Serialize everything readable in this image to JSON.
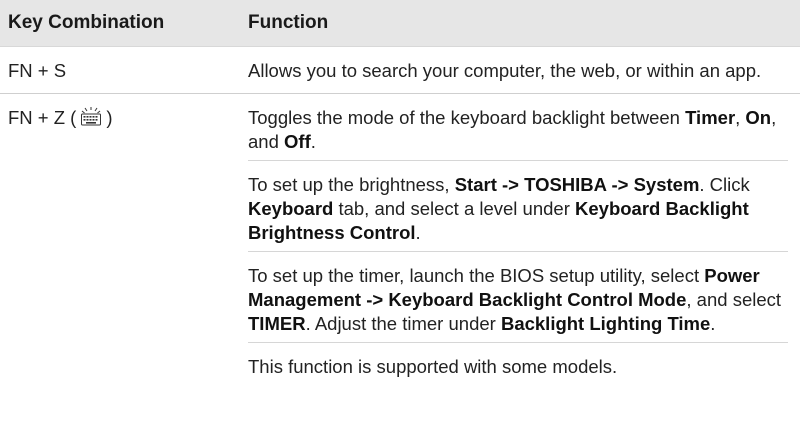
{
  "header": {
    "col_key": "Key Combination",
    "col_function": "Function"
  },
  "rows": [
    {
      "key": "FN + S",
      "paragraphs": [
        [
          {
            "t": "Allows you to search your computer, the web, or within an app.",
            "b": false
          }
        ]
      ]
    },
    {
      "key_prefix": "FN + Z (",
      "key_icon": "keyboard-backlight-icon",
      "key_suffix": ")",
      "paragraphs": [
        [
          {
            "t": "Toggles the mode of the keyboard backlight between ",
            "b": false
          },
          {
            "t": "Timer",
            "b": true
          },
          {
            "t": ", ",
            "b": false
          },
          {
            "t": "On",
            "b": true
          },
          {
            "t": ", and ",
            "b": false
          },
          {
            "t": "Off",
            "b": true
          },
          {
            "t": ".",
            "b": false
          }
        ],
        [
          {
            "t": "To set up the brightness, ",
            "b": false
          },
          {
            "t": "Start -> TOSHIBA -> System",
            "b": true
          },
          {
            "t": ". Click ",
            "b": false
          },
          {
            "t": "Keyboard",
            "b": true
          },
          {
            "t": " tab, and select a level under ",
            "b": false
          },
          {
            "t": "Keyboard Backlight Brightness Control",
            "b": true
          },
          {
            "t": ".",
            "b": false
          }
        ],
        [
          {
            "t": "To set up the timer, launch the BIOS setup utility, select ",
            "b": false
          },
          {
            "t": "Power Management -> Keyboard Backlight Control Mode",
            "b": true
          },
          {
            "t": ", and select ",
            "b": false
          },
          {
            "t": "TIMER",
            "b": true
          },
          {
            "t": ". Adjust the timer under ",
            "b": false
          },
          {
            "t": "Backlight Lighting Time",
            "b": true
          },
          {
            "t": ".",
            "b": false
          }
        ],
        [
          {
            "t": "This function is supported with some models.",
            "b": false
          }
        ]
      ]
    }
  ]
}
